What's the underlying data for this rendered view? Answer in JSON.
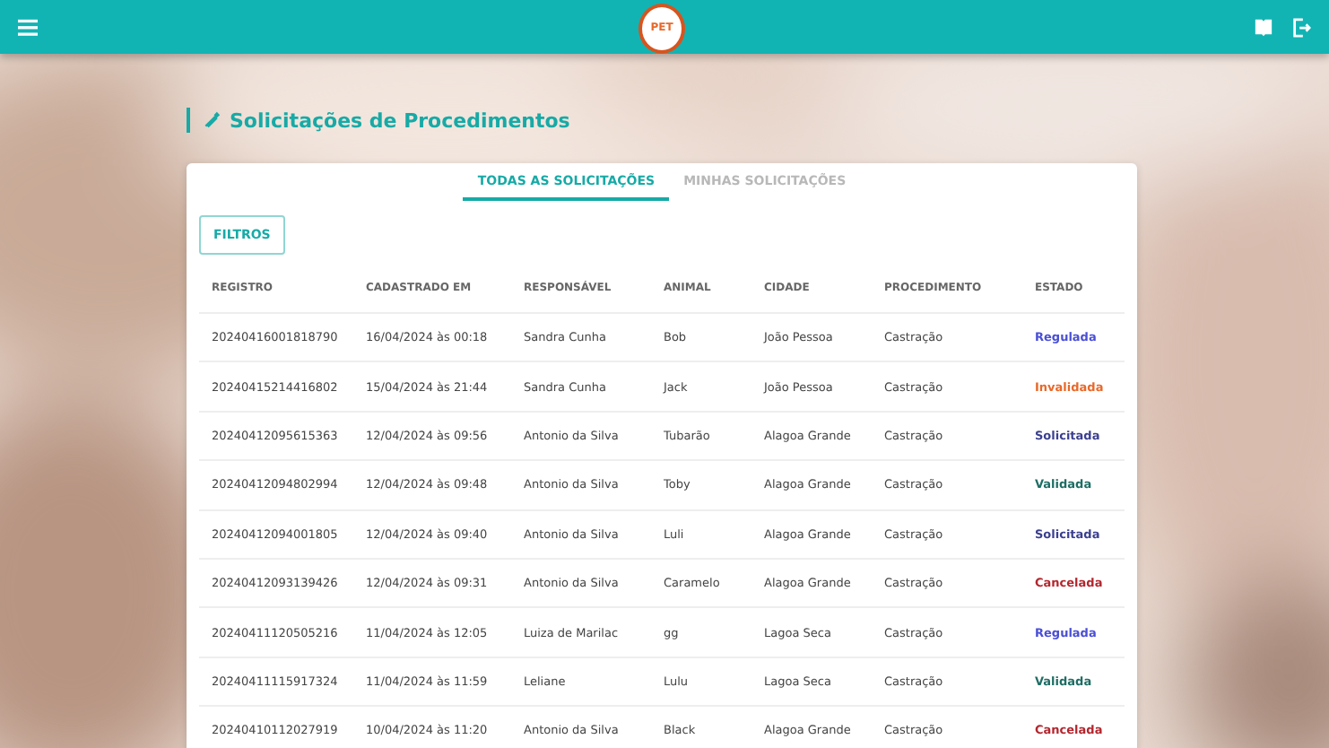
{
  "header": {
    "logo_text": "PET"
  },
  "page_title": "Solicitações de Procedimentos",
  "tabs": [
    {
      "label": "TODAS AS SOLICITAÇÕES",
      "selected": true
    },
    {
      "label": "MINHAS SOLICITAÇÕES",
      "selected": false
    }
  ],
  "filter_button": "FILTROS",
  "table": {
    "columns": [
      "REGISTRO",
      "CADASTRADO EM",
      "RESPONSÁVEL",
      "ANIMAL",
      "CIDADE",
      "PROCEDIMENTO",
      "ESTADO"
    ],
    "rows": [
      {
        "cells": [
          "20240416001818790",
          "16/04/2024 às 00:18",
          "Sandra Cunha",
          "Bob",
          "João Pessoa",
          "Castração"
        ],
        "status": "Regulada",
        "color": "#4a4fd6"
      },
      {
        "cells": [
          "20240415214416802",
          "15/04/2024 às 21:44",
          "Sandra Cunha",
          "Jack",
          "João Pessoa",
          "Castração"
        ],
        "status": "Invalidada",
        "color": "#e8692a"
      },
      {
        "cells": [
          "20240412095615363",
          "12/04/2024 às 09:56",
          "Antonio da Silva",
          "Tubarão",
          "Alagoa Grande",
          "Castração"
        ],
        "status": "Solicitada",
        "color": "#3b3f8f"
      },
      {
        "cells": [
          "20240412094802994",
          "12/04/2024 às 09:48",
          "Antonio da Silva",
          "Toby",
          "Alagoa Grande",
          "Castração"
        ],
        "status": "Validada",
        "color": "#1e6e64"
      },
      {
        "cells": [
          "20240412094001805",
          "12/04/2024 às 09:40",
          "Antonio da Silva",
          "Luli",
          "Alagoa Grande",
          "Castração"
        ],
        "status": "Solicitada",
        "color": "#3b3f8f"
      },
      {
        "cells": [
          "20240412093139426",
          "12/04/2024 às 09:31",
          "Antonio da Silva",
          "Caramelo",
          "Alagoa Grande",
          "Castração"
        ],
        "status": "Cancelada",
        "color": "#b3262e"
      },
      {
        "cells": [
          "20240411120505216",
          "11/04/2024 às 12:05",
          "Luiza de Marilac",
          "gg",
          "Lagoa Seca",
          "Castração"
        ],
        "status": "Regulada",
        "color": "#4a4fd6"
      },
      {
        "cells": [
          "20240411115917324",
          "11/04/2024 às 11:59",
          "Leliane",
          "Lulu",
          "Lagoa Seca",
          "Castração"
        ],
        "status": "Validada",
        "color": "#1e6e64"
      },
      {
        "cells": [
          "20240410112027919",
          "10/04/2024 às 11:20",
          "Antonio da Silva",
          "Black",
          "Alagoa Grande",
          "Castração"
        ],
        "status": "Cancelada",
        "color": "#b3262e"
      }
    ]
  }
}
